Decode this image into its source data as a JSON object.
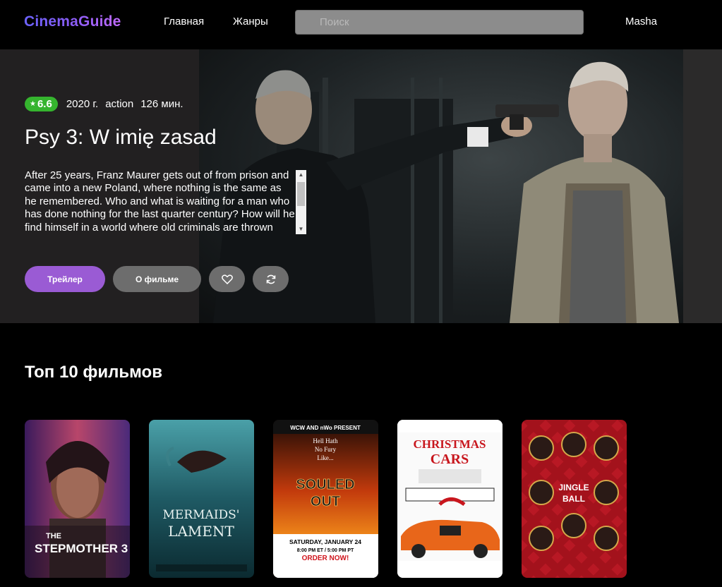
{
  "header": {
    "logo": "CinemaGuide",
    "nav": {
      "home": "Главная",
      "genres": "Жанры"
    },
    "search_placeholder": "Поиск",
    "user": "Masha"
  },
  "hero": {
    "rating": "6.6",
    "year": "2020 г.",
    "genre": "action",
    "duration": "126 мин.",
    "title": "Psy 3: W imię zasad",
    "description": "After 25 years, Franz Maurer gets out of from prison and came into a new Poland, where nothing is the same as he remembered. Who and what is waiting for a man who has done nothing for the last quarter century? How will he find himself in a world where old criminals are thrown aside, lawlessness reigns and he is left alone.",
    "buttons": {
      "trailer": "Трейлер",
      "about": "О фильме"
    },
    "icons": {
      "favorite": "heart-icon",
      "refresh": "refresh-icon",
      "rating": "star-icon"
    },
    "colors": {
      "rating_badge": "#35b42e",
      "trailer_button": "#9a5bd4"
    }
  },
  "top10": {
    "title": "Топ 10 фильмов",
    "posters": [
      {
        "title_line1": "THE",
        "title_line2": "STEPMOTHER 3"
      },
      {
        "title_line1": "MERMAIDS'",
        "title_line2": "LAMENT"
      },
      {
        "header": "WCW AND nWo PRESENT",
        "tagline1": "Hell Hath",
        "tagline2": "No Fury",
        "tagline3": "Like...",
        "title_line1": "SOULED",
        "title_line2": "OUT",
        "date": "SATURDAY, JANUARY 24",
        "time": "8:00 PM ET / 5:00 PM PT",
        "cta": "ORDER NOW!"
      },
      {
        "title_line1": "CHRISTMAS",
        "title_line2": "CARS"
      },
      {
        "title_line1": "JINGLE",
        "title_line2": "BALL"
      }
    ]
  }
}
